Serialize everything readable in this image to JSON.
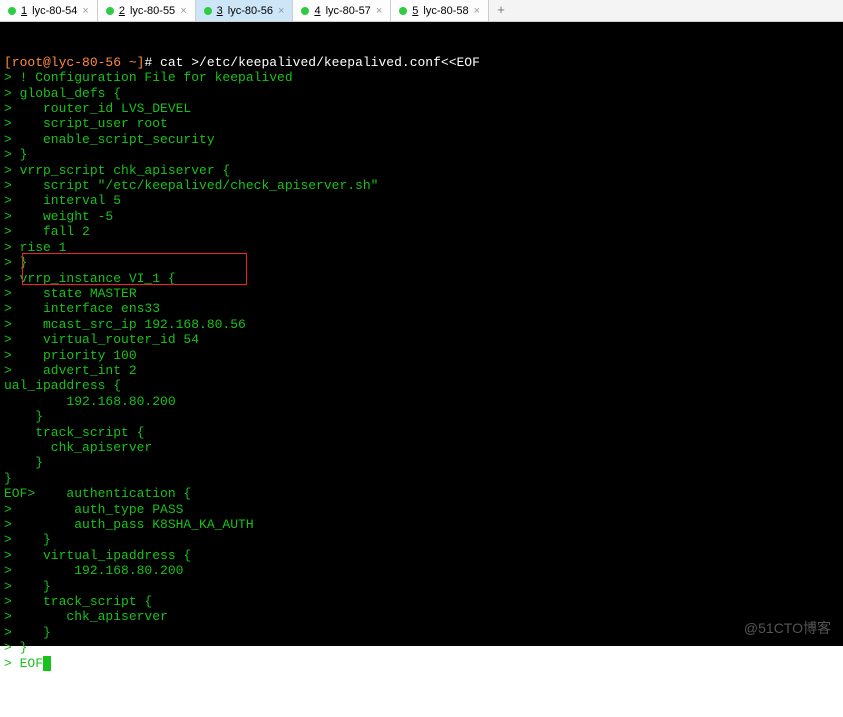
{
  "tabs": [
    {
      "index": "1",
      "label": "lyc-80-54",
      "active": false
    },
    {
      "index": "2",
      "label": "lyc-80-55",
      "active": false
    },
    {
      "index": "3",
      "label": "lyc-80-56",
      "active": true
    },
    {
      "index": "4",
      "label": "lyc-80-57",
      "active": false
    },
    {
      "index": "5",
      "label": "lyc-80-58",
      "active": false
    }
  ],
  "add_tab": "+",
  "close_glyph": "×",
  "prompt": {
    "userhost": "[root@lyc-80-56 ~]",
    "hash": "#",
    "command": " cat >/etc/keepalived/keepalived.conf<<EOF"
  },
  "lines": [
    "> ! Configuration File for keepalived",
    "> global_defs {",
    ">    router_id LVS_DEVEL",
    ">    script_user root",
    ">    enable_script_security",
    "> }",
    "> vrrp_script chk_apiserver {",
    ">    script \"/etc/keepalived/check_apiserver.sh\"",
    ">    interval 5",
    ">    weight -5",
    ">    fall 2",
    "> rise 1",
    "> }",
    "> vrrp_instance VI_1 {",
    ">    state MASTER",
    ">    interface ens33",
    ">    mcast_src_ip 192.168.80.56",
    ">    virtual_router_id 54",
    ">    priority 100",
    ">    advert_int 2",
    "ual_ipaddress {",
    "        192.168.80.200",
    "    }",
    "    track_script {",
    "      chk_apiserver",
    "    }",
    "}",
    "EOF>    authentication {",
    ">        auth_type PASS",
    ">        auth_pass K8SHA_KA_AUTH",
    ">    }",
    ">    virtual_ipaddress {",
    ">        192.168.80.200",
    ">    }",
    ">    track_script {",
    ">       chk_apiserver",
    ">    }",
    "> }"
  ],
  "last_prefix": "> EOF",
  "watermark": "@51CTO博客"
}
